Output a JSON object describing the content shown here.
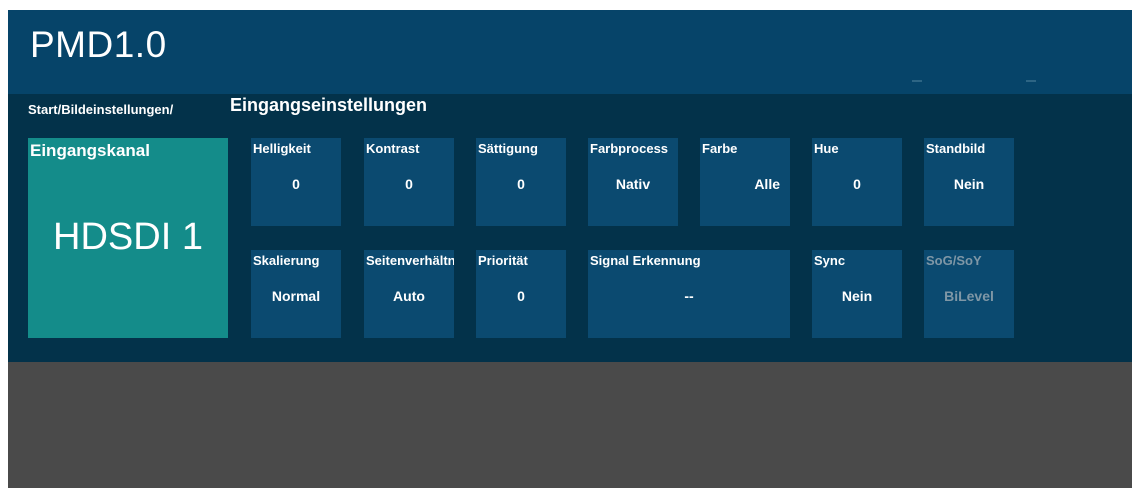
{
  "header": {
    "title": "PMD1.0"
  },
  "breadcrumb": "Start/Bildeinstellungen/",
  "page_title": "Eingangseinstellungen",
  "channel": {
    "label": "Eingangskanal",
    "value": "HDSDI 1"
  },
  "row1": [
    {
      "label": "Helligkeit",
      "value": "0"
    },
    {
      "label": "Kontrast",
      "value": "0"
    },
    {
      "label": "Sättigung",
      "value": "0"
    },
    {
      "label": "Farbprocess",
      "value": "Nativ"
    },
    {
      "label": "Farbe",
      "value": "Alle"
    },
    {
      "label": "Hue",
      "value": "0"
    },
    {
      "label": "Standbild",
      "value": "Nein"
    }
  ],
  "row2": [
    {
      "label": "Skalierung",
      "value": "Normal"
    },
    {
      "label": "Seitenverhältnis",
      "value": "Auto"
    },
    {
      "label": "Priorität",
      "value": "0"
    },
    {
      "label": "Signal Erkennung",
      "value": "--"
    },
    {
      "label": "Sync",
      "value": "Nein"
    },
    {
      "label": "SoG/SoY",
      "value": "BiLevel"
    }
  ],
  "colors": {
    "header": "#064469",
    "content": "#03324a",
    "tile": "#0b4a70",
    "channel_tile": "#148c8a",
    "background": "#4a4a4a"
  }
}
